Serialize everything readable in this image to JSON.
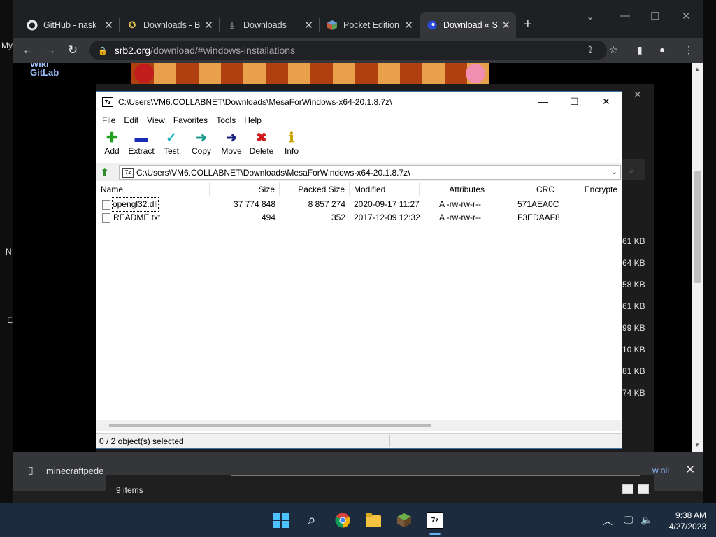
{
  "desktop": {
    "fragments": [
      "My",
      "N",
      "E"
    ]
  },
  "browser": {
    "tabs": [
      {
        "title": "GitHub - nask",
        "icon": "github-icon"
      },
      {
        "title": "Downloads - B",
        "icon": "srb2-icon"
      },
      {
        "title": "Downloads",
        "icon": "download-icon"
      },
      {
        "title": "Pocket Edition",
        "icon": "cube-icon"
      },
      {
        "title": "Download « S",
        "icon": "sonic-icon"
      }
    ],
    "url_host": "srb2.org",
    "url_path": "/download/#windows-installations",
    "page_links": [
      "Wiki",
      "GitLab"
    ],
    "file_sizes": [
      "61 KB",
      "64 KB",
      "58 KB",
      "61 KB",
      "99 KB",
      "10 KB",
      "81 KB",
      "74 KB"
    ],
    "download_bar": {
      "file_name": "minecraftpede",
      "show_all": "w all"
    }
  },
  "explorer_status": {
    "items": "9 items"
  },
  "zip_window": {
    "title": "C:\\Users\\VM6.COLLABNET\\Downloads\\MesaForWindows-x64-20.1.8.7z\\",
    "menu": [
      "File",
      "Edit",
      "View",
      "Favorites",
      "Tools",
      "Help"
    ],
    "toolbar": [
      "Add",
      "Extract",
      "Test",
      "Copy",
      "Move",
      "Delete",
      "Info"
    ],
    "address": "C:\\Users\\VM6.COLLABNET\\Downloads\\MesaForWindows-x64-20.1.8.7z\\",
    "columns": [
      "Name",
      "Size",
      "Packed Size",
      "Modified",
      "Attributes",
      "CRC",
      "Encrypte"
    ],
    "rows": [
      {
        "name": "opengl32.dll",
        "size": "37 774 848",
        "packed": "8 857 274",
        "modified": "2020-09-17 11:27",
        "attributes": "A -rw-rw-r--",
        "crc": "571AEA0C"
      },
      {
        "name": "README.txt",
        "size": "494",
        "packed": "352",
        "modified": "2017-12-09 12:32",
        "attributes": "A -rw-rw-r--",
        "crc": "F3EDAAF8"
      }
    ],
    "status": "0 / 2 object(s) selected"
  },
  "taskbar": {
    "time": "9:38 AM",
    "date": "4/27/2023"
  },
  "colors": {
    "taskbar": "#1c2b3d",
    "chrome_dark": "#35363a",
    "accent": "#5fb3f5"
  }
}
